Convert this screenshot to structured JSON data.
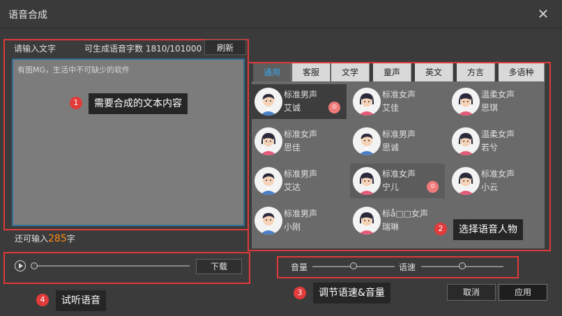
{
  "window": {
    "title": "语音合成",
    "close_glyph": "✕"
  },
  "input_panel": {
    "label": "请输入文字",
    "quota_label": "可生成语音字数 1810/101000",
    "refresh_label": "刷新",
    "placeholder": "有图MG，生活中不可缺少的软件",
    "remain_prefix": "还可输入",
    "remain_count": "285",
    "remain_suffix": "字"
  },
  "tabs": [
    {
      "label": "通用",
      "active": true
    },
    {
      "label": "客服"
    },
    {
      "label": "文学"
    },
    {
      "label": "童声"
    },
    {
      "label": "英文"
    },
    {
      "label": "方言"
    },
    {
      "label": "多语种"
    }
  ],
  "voices": [
    {
      "type": "标准男声",
      "name": "艾诚",
      "gender": "male",
      "state": "selected",
      "sound": true
    },
    {
      "type": "标准女声",
      "name": "艾佳",
      "gender": "female"
    },
    {
      "type": "温柔女声",
      "name": "思琪",
      "gender": "female"
    },
    {
      "type": "标准女声",
      "name": "思佳",
      "gender": "female"
    },
    {
      "type": "标准男声",
      "name": "思诚",
      "gender": "male"
    },
    {
      "type": "温柔女声",
      "name": "若兮",
      "gender": "female"
    },
    {
      "type": "标准男声",
      "name": "艾达",
      "gender": "male"
    },
    {
      "type": "标准女声",
      "name": "宁儿",
      "gender": "female",
      "state": "hover",
      "sound": true
    },
    {
      "type": "标准女声",
      "name": "小云",
      "gender": "female"
    },
    {
      "type": "标准男声",
      "name": "小刚",
      "gender": "male"
    },
    {
      "type": "标å□□女声",
      "name": "瑞琳",
      "gender": "female"
    }
  ],
  "player": {
    "download_label": "下载",
    "progress": 0
  },
  "adjust": {
    "volume_label": "音量",
    "speed_label": "语速",
    "volume_level": 0.5,
    "speed_level": 0.5
  },
  "footer": {
    "cancel_label": "取消",
    "ok_label": "应用"
  },
  "annotations": {
    "a1": {
      "num": "1",
      "text": "需要合成的文本内容"
    },
    "a2": {
      "num": "2",
      "text": "选择语音人物"
    },
    "a3": {
      "num": "3",
      "text": "调节语速&音量"
    },
    "a4": {
      "num": "4",
      "text": "试听语音"
    }
  },
  "colors": {
    "accent": "#3aa7e8",
    "annotation_red": "#e03a3a",
    "count_orange": "#ff8c1a"
  },
  "icons": {
    "close": "close-icon",
    "play": "play-icon",
    "sound": "sound-icon"
  }
}
